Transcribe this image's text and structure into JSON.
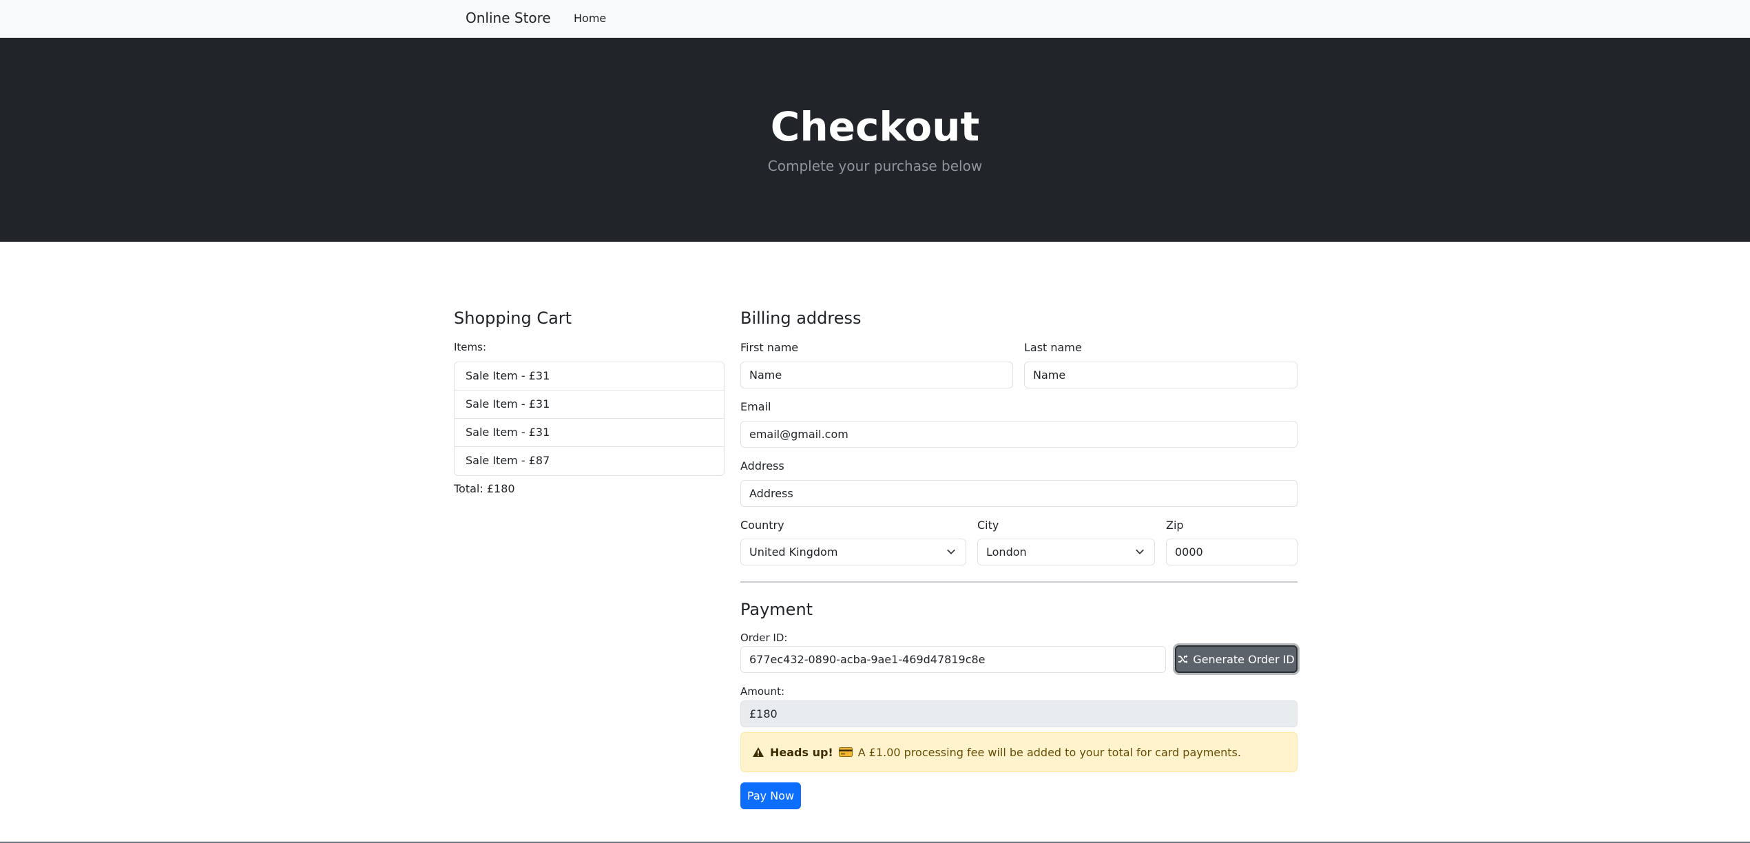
{
  "nav": {
    "brand": "Online Store",
    "home": "Home"
  },
  "hero": {
    "title": "Checkout",
    "subtitle": "Complete your purchase below"
  },
  "cart": {
    "heading": "Shopping Cart",
    "items_label": "Items:",
    "items": [
      "Sale Item - £31",
      "Sale Item - £31",
      "Sale Item - £31",
      "Sale Item - £87"
    ],
    "total": "Total: £180"
  },
  "billing": {
    "heading": "Billing address",
    "first_name_label": "First name",
    "first_name_value": "Name",
    "last_name_label": "Last name",
    "last_name_value": "Name",
    "email_label": "Email",
    "email_value": "email@gmail.com",
    "address_label": "Address",
    "address_value": "Address",
    "country_label": "Country",
    "country_value": "United Kingdom",
    "city_label": "City",
    "city_value": "London",
    "zip_label": "Zip",
    "zip_value": "0000"
  },
  "payment": {
    "heading": "Payment",
    "order_id_label": "Order ID:",
    "order_id_value": "677ec432-0890-acba-9ae1-469d47819c8e",
    "generate_button": "Generate Order ID",
    "amount_label": "Amount:",
    "amount_value": "£180",
    "alert_strong": "Heads up!",
    "alert_text": "A £1.00 processing fee will be added to your total for card payments.",
    "pay_button": "Pay Now"
  },
  "icons": [
    "warning-icon",
    "credit-card-icon",
    "shuffle-icon",
    "chevron-down-icon"
  ],
  "colors": {
    "hero_bg": "#212529",
    "primary": "#0d6efd",
    "secondary": "#5c636a",
    "alert_bg": "#fff3cd"
  }
}
